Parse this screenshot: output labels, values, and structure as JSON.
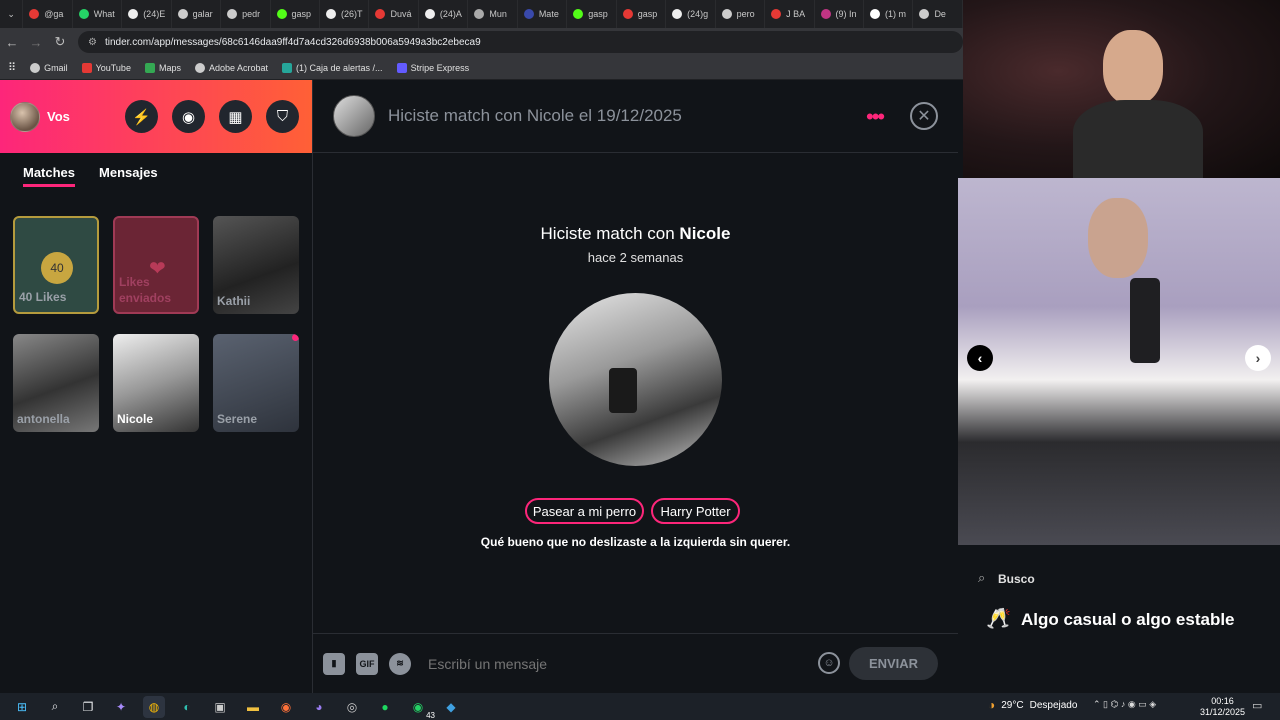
{
  "browser": {
    "tabs": [
      "@ga",
      "What",
      "(24)E",
      "galar",
      "pedr",
      "gasp",
      "(26)T",
      "Duvá",
      "(24)A",
      "Mun",
      "Mate",
      "gasp",
      "gasp",
      "(24)g",
      "pero",
      "J BA",
      "(9) In",
      "(1) m",
      "De"
    ],
    "url": "tinder.com/app/messages/68c6146daa9ff4d7a4cd326d6938b006a5949a3bc2ebeca9",
    "bookmarks": [
      "Gmail",
      "YouTube",
      "Maps",
      "Adobe Acrobat",
      "(1) Caja de alertas /...",
      "Stripe Express"
    ]
  },
  "sidebar": {
    "user_name": "Vos",
    "tabs": [
      "Matches",
      "Mensajes"
    ],
    "likes_count": "40",
    "cards": [
      "40 Likes",
      "Likes enviados",
      "Kathii",
      "antonella",
      "Nicole",
      "Serene"
    ]
  },
  "chat": {
    "header_title": "Hiciste match con Nicole el 19/12/2025",
    "match_prefix": "Hiciste match con ",
    "match_name": "Nicole",
    "time_ago": "hace 2 semanas",
    "interests": [
      "Pasear a mi perro",
      "Harry Potter"
    ],
    "glad_text": "Qué bueno que no deslizaste a la izquierda sin querer.",
    "gif_label": "GIF",
    "input_placeholder": "Escribí un mensaje",
    "send_label": "ENVIAR"
  },
  "profile": {
    "looking_for_label": "Busco",
    "looking_for_value": "Algo casual o algo estable"
  },
  "taskbar": {
    "temperature": "29°C",
    "weather": "Despejado",
    "time": "00:16",
    "date": "31/12/2025",
    "whatsapp_badge": "43"
  },
  "colors": {
    "accent": "#fd267a",
    "accent2": "#ff6036",
    "bg": "#111418"
  }
}
